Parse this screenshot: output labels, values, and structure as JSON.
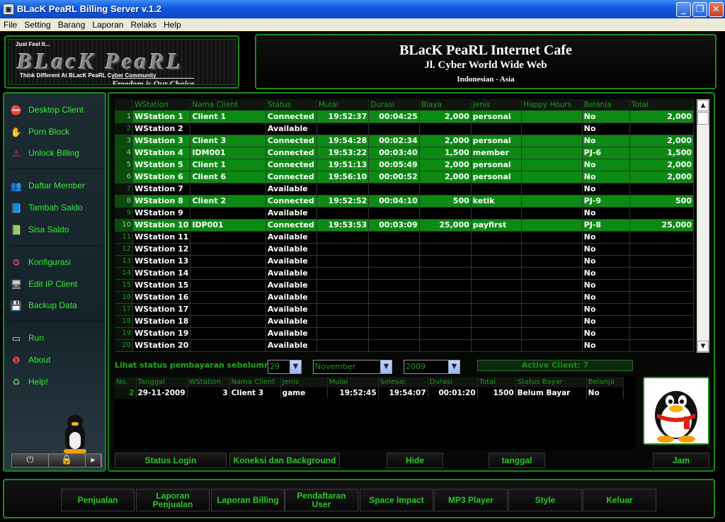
{
  "window": {
    "title": "BLacK PeaRL Billing Server v.1.2"
  },
  "menu": [
    "File",
    "Setting",
    "Barang",
    "Laporan",
    "Relaks",
    "Help"
  ],
  "logo": {
    "tagline": "Just Feel It...",
    "brand": "BLacK PeaRL",
    "slogan": "Think Different At BLacK PeaRL Cyber Community",
    "motto": "Freedom is Our Choice"
  },
  "header": {
    "title": "BLacK PeaRL Internet Cafe",
    "address": "Jl. Cyber World Wide Web",
    "region": "Indonesian - Asia"
  },
  "sidebar": {
    "items": [
      "Desktop Client",
      "Porn Block",
      "Unlock Billing",
      "Daftar Member",
      "Tambah Saldo",
      "Sisa Saldo",
      "Konfigurasi",
      "Edit IP Client",
      "Backup Data",
      "Run",
      "About",
      "Help!"
    ]
  },
  "grid": {
    "columns": [
      "WStation",
      "Nama Client",
      "Status",
      "Mulai",
      "Durasi",
      "Biaya",
      "Jenis",
      "Happy Hours",
      "Belanja",
      "Total"
    ],
    "rows": [
      {
        "no": "1",
        "ws": "WStation 1",
        "client": "Client 1",
        "status": "Connected",
        "mulai": "19:52:37",
        "durasi": "00:04:25",
        "biaya": "2,000",
        "jenis": "personal",
        "happy": "",
        "belanja": "No",
        "total": "2,000"
      },
      {
        "no": "2",
        "ws": "WStation 2",
        "client": "",
        "status": "Available",
        "mulai": "",
        "durasi": "",
        "biaya": "",
        "jenis": "",
        "happy": "",
        "belanja": "No",
        "total": ""
      },
      {
        "no": "3",
        "ws": "WStation 3",
        "client": "Client 3",
        "status": "Connected",
        "mulai": "19:54:28",
        "durasi": "00:02:34",
        "biaya": "2,000",
        "jenis": "personal",
        "happy": "",
        "belanja": "No",
        "total": "2,000"
      },
      {
        "no": "4",
        "ws": "WStation 4",
        "client": "IDM001",
        "status": "Connected",
        "mulai": "19:53:22",
        "durasi": "00:03:40",
        "biaya": "1,500",
        "jenis": "member",
        "happy": "",
        "belanja": "PJ-6",
        "total": "1,500"
      },
      {
        "no": "5",
        "ws": "WStation 5",
        "client": "Client 1",
        "status": "Connected",
        "mulai": "19:51:13",
        "durasi": "00:05:49",
        "biaya": "2,000",
        "jenis": "personal",
        "happy": "",
        "belanja": "No",
        "total": "2,000"
      },
      {
        "no": "6",
        "ws": "WStation 6",
        "client": "Client 6",
        "status": "Connected",
        "mulai": "19:56:10",
        "durasi": "00:00:52",
        "biaya": "2,000",
        "jenis": "personal",
        "happy": "",
        "belanja": "No",
        "total": "2,000"
      },
      {
        "no": "7",
        "ws": "WStation 7",
        "client": "",
        "status": "Available",
        "mulai": "",
        "durasi": "",
        "biaya": "",
        "jenis": "",
        "happy": "",
        "belanja": "No",
        "total": ""
      },
      {
        "no": "8",
        "ws": "WStation 8",
        "client": "Client 2",
        "status": "Connected",
        "mulai": "19:52:52",
        "durasi": "00:04:10",
        "biaya": "500",
        "jenis": "ketik",
        "happy": "",
        "belanja": "PJ-9",
        "total": "500"
      },
      {
        "no": "9",
        "ws": "WStation 9",
        "client": "",
        "status": "Available",
        "mulai": "",
        "durasi": "",
        "biaya": "",
        "jenis": "",
        "happy": "",
        "belanja": "No",
        "total": ""
      },
      {
        "no": "10",
        "ws": "WStation 10",
        "client": "IDP001",
        "status": "Connected",
        "mulai": "19:53:53",
        "durasi": "00:03:09",
        "biaya": "25,000",
        "jenis": "payfirst",
        "happy": "",
        "belanja": "PJ-8",
        "total": "25,000"
      },
      {
        "no": "11",
        "ws": "WStation 11",
        "client": "",
        "status": "Available",
        "mulai": "",
        "durasi": "",
        "biaya": "",
        "jenis": "",
        "happy": "",
        "belanja": "No",
        "total": ""
      },
      {
        "no": "12",
        "ws": "WStation 12",
        "client": "",
        "status": "Available",
        "mulai": "",
        "durasi": "",
        "biaya": "",
        "jenis": "",
        "happy": "",
        "belanja": "No",
        "total": ""
      },
      {
        "no": "13",
        "ws": "WStation 13",
        "client": "",
        "status": "Available",
        "mulai": "",
        "durasi": "",
        "biaya": "",
        "jenis": "",
        "happy": "",
        "belanja": "No",
        "total": ""
      },
      {
        "no": "14",
        "ws": "WStation 14",
        "client": "",
        "status": "Available",
        "mulai": "",
        "durasi": "",
        "biaya": "",
        "jenis": "",
        "happy": "",
        "belanja": "No",
        "total": ""
      },
      {
        "no": "15",
        "ws": "WStation 15",
        "client": "",
        "status": "Available",
        "mulai": "",
        "durasi": "",
        "biaya": "",
        "jenis": "",
        "happy": "",
        "belanja": "No",
        "total": ""
      },
      {
        "no": "16",
        "ws": "WStation 16",
        "client": "",
        "status": "Available",
        "mulai": "",
        "durasi": "",
        "biaya": "",
        "jenis": "",
        "happy": "",
        "belanja": "No",
        "total": ""
      },
      {
        "no": "17",
        "ws": "WStation 17",
        "client": "",
        "status": "Available",
        "mulai": "",
        "durasi": "",
        "biaya": "",
        "jenis": "",
        "happy": "",
        "belanja": "No",
        "total": ""
      },
      {
        "no": "18",
        "ws": "WStation 18",
        "client": "",
        "status": "Available",
        "mulai": "",
        "durasi": "",
        "biaya": "",
        "jenis": "",
        "happy": "",
        "belanja": "No",
        "total": ""
      },
      {
        "no": "19",
        "ws": "WStation 19",
        "client": "",
        "status": "Available",
        "mulai": "",
        "durasi": "",
        "biaya": "",
        "jenis": "",
        "happy": "",
        "belanja": "No",
        "total": ""
      },
      {
        "no": "20",
        "ws": "WStation 20",
        "client": "",
        "status": "Available",
        "mulai": "",
        "durasi": "",
        "biaya": "",
        "jenis": "",
        "happy": "",
        "belanja": "No",
        "total": ""
      }
    ]
  },
  "filter": {
    "label": "Lihat status pembayaran sebelumnya",
    "day": "29",
    "month": "November",
    "year": "2009",
    "active": "Active Client: 7"
  },
  "detail": {
    "columns": [
      "No.",
      "Tanggal",
      "WStation",
      "Nama Client",
      "Jenis",
      "Mulai",
      "Selesai",
      "Durasi",
      "Total",
      "Status Bayar",
      "Belanja"
    ],
    "rows": [
      {
        "no": "2",
        "tanggal": "29-11-2009",
        "ws": "3",
        "client": "Client 3",
        "jenis": "game",
        "mulai": "19:52:45",
        "selesai": "19:54:07",
        "durasi": "00:01:20",
        "total": "1500",
        "status": "Belum Bayar",
        "belanja": "No"
      }
    ]
  },
  "buttons": {
    "status_login": "Status Login",
    "koneksi": "Koneksi dan Background",
    "hide": "Hide",
    "tanggal": "tanggal",
    "jam": "Jam"
  },
  "footer": [
    "Penjualan",
    "Laporan Penjualan",
    "Laporan Billing",
    "Pendaftaran User",
    "Space Impact",
    "MP3 Player",
    "Style",
    "Keluar"
  ],
  "colors": {
    "accent": "#28c828",
    "connected_row": "#0c8a13",
    "border": "#1a8a1a"
  }
}
